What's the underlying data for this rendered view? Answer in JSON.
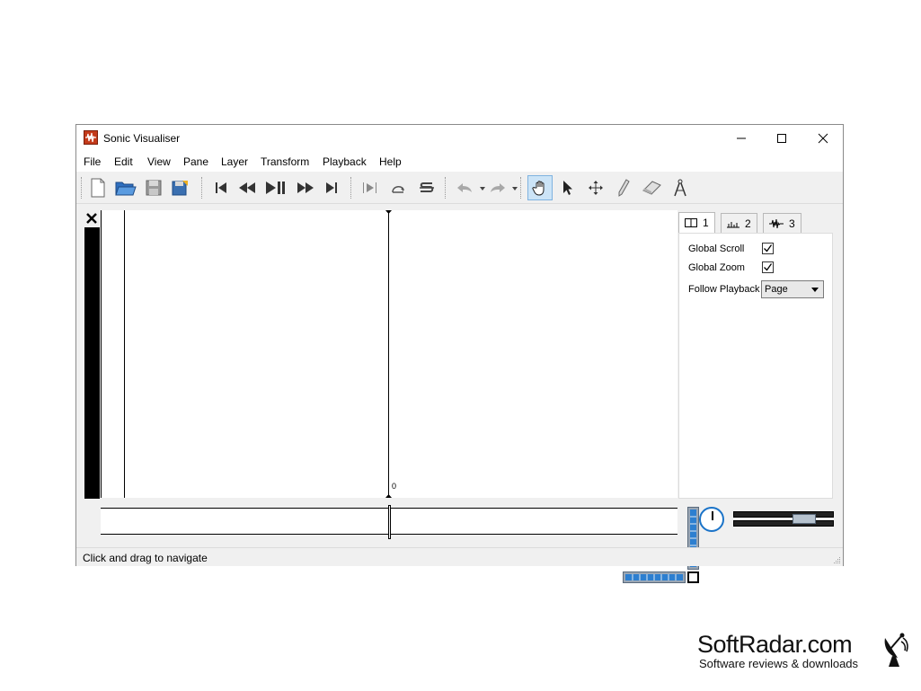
{
  "window": {
    "title": "Sonic Visualiser"
  },
  "menu": {
    "items": [
      "File",
      "Edit",
      "View",
      "Pane",
      "Layer",
      "Transform",
      "Playback",
      "Help"
    ]
  },
  "toolbar": {
    "icons": [
      "new-file-icon",
      "open-folder-icon",
      "save-icon",
      "save-as-icon",
      "rewind-start-icon",
      "rewind-icon",
      "play-pause-icon",
      "fast-forward-icon",
      "fast-forward-end-icon",
      "play-selection-icon",
      "loop-icon",
      "solo-icon",
      "undo-icon",
      "redo-icon",
      "navigate-hand-icon",
      "select-arrow-icon",
      "move-icon",
      "draw-pencil-icon",
      "erase-icon",
      "measure-icon"
    ],
    "active_tool": "navigate-hand-icon"
  },
  "pane": {
    "zero_label": "0"
  },
  "property_panel": {
    "tabs": [
      {
        "label": "1",
        "icon": "pane-icon"
      },
      {
        "label": "2",
        "icon": "ruler-icon"
      },
      {
        "label": "3",
        "icon": "waveform-icon"
      }
    ],
    "active_tab": "1",
    "global_scroll_label": "Global Scroll",
    "global_scroll_checked": true,
    "global_zoom_label": "Global Zoom",
    "global_zoom_checked": true,
    "follow_playback_label": "Follow Playback",
    "follow_playback_value": "Page"
  },
  "status": {
    "text": "Click and drag to navigate"
  },
  "watermark": {
    "title": "SoftRadar.com",
    "subtitle": "Software reviews & downloads"
  },
  "colors": {
    "accent": "#1a73c8",
    "active_tool_bg": "#cce4f7",
    "app_icon": "#c43a1a"
  }
}
